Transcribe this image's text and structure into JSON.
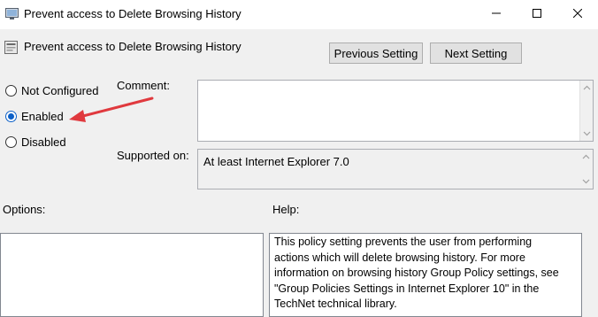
{
  "window": {
    "title": "Prevent access to Delete Browsing History"
  },
  "header": {
    "title": "Prevent access to Delete Browsing History",
    "previous_button": "Previous Setting",
    "next_button": "Next Setting"
  },
  "state": {
    "options": [
      {
        "label": "Not Configured",
        "selected": false
      },
      {
        "label": "Enabled",
        "selected": true
      },
      {
        "label": "Disabled",
        "selected": false
      }
    ]
  },
  "comment": {
    "label": "Comment:",
    "value": ""
  },
  "supported": {
    "label": "Supported on:",
    "value": "At least Internet Explorer 7.0"
  },
  "options_panel": {
    "label": "Options:"
  },
  "help_panel": {
    "label": "Help:",
    "lines": [
      "This policy setting prevents the user from performing",
      "actions which will delete browsing history. For more",
      "information on browsing history Group Policy settings, see",
      "\"Group Policies Settings in Internet Explorer 10\" in the",
      "TechNet technical library."
    ]
  },
  "colors": {
    "annotation_arrow": "#e0393e",
    "radio_selected": "#0b5fc7"
  },
  "icons": {
    "app": "policy-setting-icon",
    "minimize": "minimize-icon",
    "maximize": "maximize-icon",
    "close": "close-icon"
  }
}
